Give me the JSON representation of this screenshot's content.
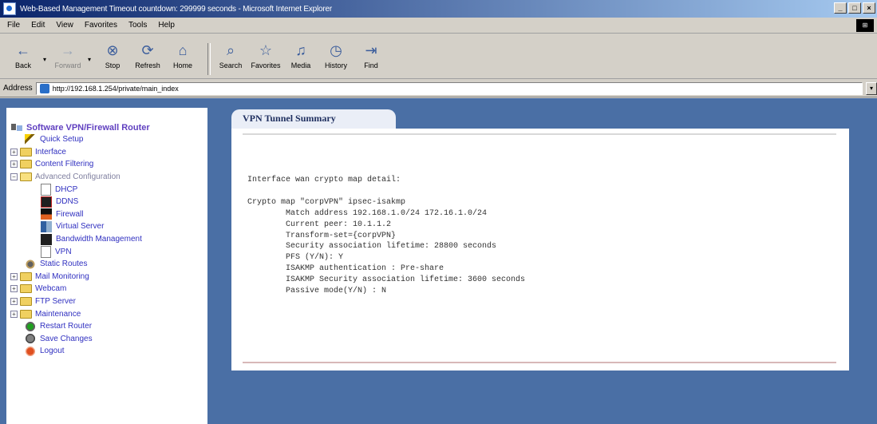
{
  "window": {
    "title": "Web-Based Management Timeout countdown: 299999 seconds - Microsoft Internet Explorer",
    "controls": [
      "_",
      "□",
      "×"
    ]
  },
  "menu": [
    "File",
    "Edit",
    "View",
    "Favorites",
    "Tools",
    "Help"
  ],
  "toolbar": {
    "back": "Back",
    "forward": "Forward",
    "stop": "Stop",
    "refresh": "Refresh",
    "home": "Home",
    "search": "Search",
    "favorites": "Favorites",
    "media": "Media",
    "history": "History",
    "find": "Find"
  },
  "address": {
    "label": "Address",
    "url": "http://192.168.1.254/private/main_index"
  },
  "sidebar": {
    "root": "Software VPN/Firewall Router",
    "items": [
      {
        "label": "Quick Setup"
      },
      {
        "label": "Interface"
      },
      {
        "label": "Content Filtering"
      },
      {
        "label": "Advanced Configuration"
      },
      {
        "label": "DHCP"
      },
      {
        "label": "DDNS"
      },
      {
        "label": "Firewall"
      },
      {
        "label": "Virtual Server"
      },
      {
        "label": "Bandwidth Management"
      },
      {
        "label": "VPN"
      },
      {
        "label": "Static Routes"
      },
      {
        "label": "Mail Monitoring"
      },
      {
        "label": "Webcam"
      },
      {
        "label": "FTP Server"
      },
      {
        "label": "Maintenance"
      },
      {
        "label": "Restart Router"
      },
      {
        "label": "Save Changes"
      },
      {
        "label": "Logout"
      }
    ]
  },
  "main": {
    "tab_title": "VPN Tunnel Summary",
    "lines": [
      "Interface wan crypto map detail:",
      "",
      "Crypto map \"corpVPN\" ipsec-isakmp",
      "        Match address 192.168.1.0/24 172.16.1.0/24",
      "        Current peer: 10.1.1.2",
      "        Transform-set={corpVPN}",
      "        Security association lifetime: 28800 seconds",
      "        PFS (Y/N): Y",
      "        ISAKMP authentication : Pre-share",
      "        ISAKMP Security association lifetime: 3600 seconds",
      "        Passive mode(Y/N) : N"
    ]
  }
}
